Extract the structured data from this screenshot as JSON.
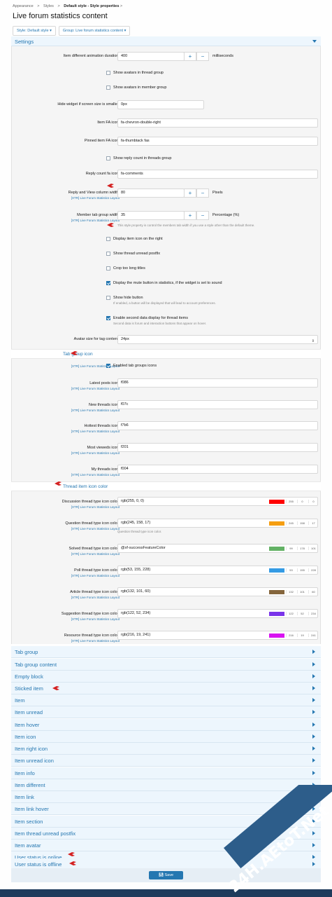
{
  "breadcrumb": [
    "Appearance",
    ">",
    "Styles",
    ">",
    "Default style - Style properties",
    ">"
  ],
  "page_title": "Live forum statistics content",
  "filters": {
    "style": "Style: Default style ▾",
    "group": "Group: Live forum statistics content ▾"
  },
  "settings_label": "Settings",
  "fields": {
    "anim_label": "Item different animation duration:",
    "anim_value": "400",
    "anim_unit": "milliseconds",
    "avatars_thread": "Show avatars in thread group",
    "avatars_member": "Show avatars in member group",
    "hide_label": "Hide widget if screen size is smaller:",
    "hide_value": "0px",
    "fa_label": "Item FA icon:",
    "fa_value": "fa-chevron-double-right",
    "pinned_label": "Pinned item FA icon:",
    "pinned_value": "fa-thumbtack fas",
    "reply_count": "Show reply count in threads group",
    "reply_icon_label": "Reply count fa icon:",
    "reply_icon_value": "fa-comments",
    "col_width_label": "Reply and View column width:",
    "col_width_sub": "[XTR] Live Forum Statistics Layout",
    "col_width_value": "80",
    "col_width_unit": "Pixels",
    "member_tab_label": "Member tab group width:",
    "member_tab_sub": "[XTR] Live Forum Statistics Layout",
    "member_tab_value": "35",
    "member_tab_unit": "Percentage (%)",
    "member_tab_hint": "This style property is control the members tab width if you use a style other than the default theme.",
    "icon_right": "Display item icon on the right",
    "unread_postfix": "Show thread unread postfix",
    "crop_titles": "Crop too long titles",
    "mute_button": "Display the mute button in statistics, if the widget is set to sound",
    "hide_button": "Show hide button",
    "hide_button_hint": "If enabled, a button will be displayed that will lead to account preferences.",
    "second_data": "Enable second data display for thread items",
    "second_data_hint": "Second data is forum and interaction buttons that appear on hover.",
    "avatar_size_label": "Avatar size for tag content:",
    "avatar_size_value": "24px"
  },
  "tab_group_icon": {
    "heading": "Tab group icon",
    "enabled_sub": "[XTR] Live Forum Statistics Layout",
    "enabled": "Enabled tab groups icons",
    "items": [
      {
        "label": "Latest posts icon:",
        "sub": "[XTR] Live Forum Statistics Layout",
        "value": "f086"
      },
      {
        "label": "New threads icon:",
        "sub": "[XTR] Live Forum Statistics Layout",
        "value": "f07c"
      },
      {
        "label": "Hottest threads icon:",
        "sub": "[XTR] Live Forum Statistics Layout",
        "value": "f7b6"
      },
      {
        "label": "Most vieweds icon:",
        "sub": "[XTR] Live Forum Statistics Layout",
        "value": "f201"
      },
      {
        "label": "My threads icon:",
        "sub": "[XTR] Live Forum Statistics Layout",
        "value": "f004"
      }
    ]
  },
  "thread_icon_color": {
    "heading": "Thread item icon color",
    "question_hint": "Question thread type icon color.",
    "items": [
      {
        "label": "Discussion thread type icon color:",
        "sub": "[XTR] Live Forum Statistics Layout",
        "value": "rgb(255, 0, 0)",
        "color": "#ff0000",
        "r": "255",
        "g": "0",
        "b": "0"
      },
      {
        "label": "Question thread type icon color:",
        "sub": "[XTR] Live Forum Statistics Layout",
        "value": "rgb(245, 158, 17)",
        "color": "#f59e11",
        "r": "245",
        "g": "158",
        "b": "17"
      },
      {
        "label": "Solved thread type icon color:",
        "sub": "[XTR] Live Forum Statistics Layout",
        "value": "@xf-successFeatureColor",
        "color": "#63b265",
        "r": "99",
        "g": "178",
        "b": "101"
      },
      {
        "label": "Poll thread type icon color:",
        "sub": "[XTR] Live Forum Statistics Layout",
        "value": "rgb(53, 155, 228)",
        "color": "#359be4",
        "r": "53",
        "g": "155",
        "b": "228"
      },
      {
        "label": "Article thread type icon color:",
        "sub": "[XTR] Live Forum Statistics Layout",
        "value": "rgb(132, 101, 60)",
        "color": "#84653c",
        "r": "132",
        "g": "101",
        "b": "60"
      },
      {
        "label": "Suggestion thread type icon color:",
        "sub": "[XTR] Live Forum Statistics Layout",
        "value": "rgb(122, 52, 234)",
        "color": "#7a34ea",
        "r": "122",
        "g": "52",
        "b": "234"
      },
      {
        "label": "Resource thread type icon color:",
        "sub": "[XTR] Live Forum Statistics Layout",
        "value": "rgb(216, 19, 241)",
        "color": "#d813f1",
        "r": "216",
        "g": "19",
        "b": "241"
      }
    ]
  },
  "collapsed_groups": [
    "Tab group",
    "Tab group content",
    "Empty block",
    "Sticked item",
    "Item",
    "Item unread",
    "Item hover",
    "Item icon",
    "Item right icon",
    "Item unread icon",
    "Item info",
    "Item different",
    "Item link",
    "Item link hover",
    "Item section",
    "Item thread unread postfix",
    "Item avatar",
    "User status is online",
    "User status is offline"
  ],
  "save_label": "Save",
  "watermark": "24H.AEtoT.Net",
  "colors": {
    "accent": "#2577b1",
    "marker": "#d42020"
  }
}
